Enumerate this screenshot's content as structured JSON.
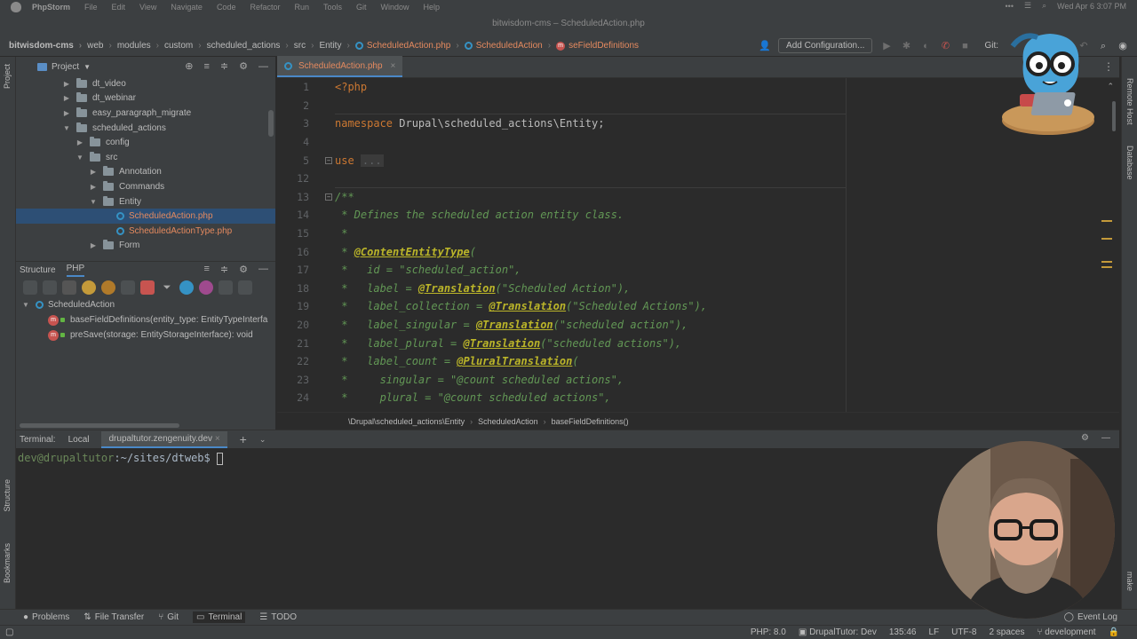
{
  "menubar": {
    "app": "PhpStorm",
    "items": [
      "File",
      "Edit",
      "View",
      "Navigate",
      "Code",
      "Refactor",
      "Run",
      "Tools",
      "Git",
      "Window",
      "Help"
    ],
    "window_title": "bitwisdom-cms – ScheduledAction.php",
    "datetime": "Wed Apr 6  3:07 PM"
  },
  "navbar": {
    "crumbs": [
      "bitwisdom-cms",
      "web",
      "modules",
      "custom",
      "scheduled_actions",
      "src",
      "Entity",
      "ScheduledAction.php",
      "ScheduledAction",
      "seFieldDefinitions"
    ],
    "add_configuration": "Add Configuration...",
    "git_label": "Git:"
  },
  "left_strip": {
    "project": "Project",
    "structure": "Structure",
    "bookmarks": "Bookmarks"
  },
  "right_strip": {
    "remote_host": "Remote Host",
    "database": "Database",
    "make": "make"
  },
  "project_pane": {
    "title": "Project",
    "tree": [
      {
        "label": "dt_video",
        "type": "folder",
        "indent": 1,
        "arrow": "▶"
      },
      {
        "label": "dt_webinar",
        "type": "folder",
        "indent": 1,
        "arrow": "▶"
      },
      {
        "label": "easy_paragraph_migrate",
        "type": "folder",
        "indent": 1,
        "arrow": "▶"
      },
      {
        "label": "scheduled_actions",
        "type": "folder",
        "indent": 1,
        "arrow": "▼"
      },
      {
        "label": "config",
        "type": "folder",
        "indent": 2,
        "arrow": "▶"
      },
      {
        "label": "src",
        "type": "folder",
        "indent": 2,
        "arrow": "▼"
      },
      {
        "label": "Annotation",
        "type": "folder",
        "indent": 3,
        "arrow": "▶"
      },
      {
        "label": "Commands",
        "type": "folder",
        "indent": 3,
        "arrow": "▶"
      },
      {
        "label": "Entity",
        "type": "folder",
        "indent": 3,
        "arrow": "▼"
      },
      {
        "label": "ScheduledAction.php",
        "type": "php",
        "indent": 4,
        "arrow": "",
        "selected": true
      },
      {
        "label": "ScheduledActionType.php",
        "type": "php",
        "indent": 4,
        "arrow": ""
      },
      {
        "label": "Form",
        "type": "folder",
        "indent": 3,
        "arrow": "▶"
      }
    ]
  },
  "structure_pane": {
    "tab_structure": "Structure",
    "tab_php": "PHP",
    "class_name": "ScheduledAction",
    "members": [
      "baseFieldDefinitions(entity_type: EntityTypeInterfa",
      "preSave(storage: EntityStorageInterface): void"
    ]
  },
  "editor": {
    "tab_label": "ScheduledAction.php",
    "lines": [
      {
        "n": "1",
        "html": "<span class='kw'>&lt;?php</span>"
      },
      {
        "n": "2",
        "html": ""
      },
      {
        "n": "3",
        "html": "<span class='kw'>namespace</span> Drupal\\scheduled_actions\\Entity;"
      },
      {
        "n": "4",
        "html": ""
      },
      {
        "n": "5",
        "html": "<span class='kw'>use</span> <span class='fold'>...</span>"
      },
      {
        "n": "12",
        "html": ""
      },
      {
        "n": "13",
        "html": "<span class='cm'>/**</span>"
      },
      {
        "n": "14",
        "html": "<span class='cm'> * Defines the scheduled action entity class.</span>"
      },
      {
        "n": "15",
        "html": "<span class='cm'> *</span>"
      },
      {
        "n": "16",
        "html": "<span class='cm'> * </span><span class='an'>@ContentEntityType</span><span class='cm'>(</span>"
      },
      {
        "n": "17",
        "html": "<span class='cm'> *   id = \"scheduled_action\",</span>"
      },
      {
        "n": "18",
        "html": "<span class='cm'> *   label = </span><span class='an'>@Translation</span><span class='cm'>(\"Scheduled Action\"),</span>"
      },
      {
        "n": "19",
        "html": "<span class='cm'> *   label_collection = </span><span class='an'>@Translation</span><span class='cm'>(\"Scheduled Actions\"),</span>"
      },
      {
        "n": "20",
        "html": "<span class='cm'> *   label_singular = </span><span class='an'>@Translation</span><span class='cm'>(\"scheduled action\"),</span>"
      },
      {
        "n": "21",
        "html": "<span class='cm'> *   label_plural = </span><span class='an'>@Translation</span><span class='cm'>(\"scheduled actions\"),</span>"
      },
      {
        "n": "22",
        "html": "<span class='cm'> *   label_count = </span><span class='an'>@PluralTranslation</span><span class='cm'>(</span>"
      },
      {
        "n": "23",
        "html": "<span class='cm'> *     singular = \"@count scheduled actions\",</span>"
      },
      {
        "n": "24",
        "html": "<span class='cm'> *     plural = \"@count scheduled actions\",</span>"
      }
    ],
    "breadcrumb": [
      "\\Drupal\\scheduled_actions\\Entity",
      "ScheduledAction",
      "baseFieldDefinitions()"
    ]
  },
  "terminal": {
    "label": "Terminal:",
    "tabs": [
      "Local",
      "drupaltutor.zengenuity.dev"
    ],
    "prompt_user": "dev@drupaltutor",
    "prompt_path": ":~/sites/dtweb$ "
  },
  "bottom_toolbar": {
    "items": [
      "Problems",
      "File Transfer",
      "Git",
      "Terminal",
      "TODO"
    ],
    "event_log": "Event Log"
  },
  "status_bar": {
    "php": "PHP: 8.0",
    "server": "DrupalTutor: Dev",
    "position": "135:46",
    "line_sep": "LF",
    "encoding": "UTF-8",
    "indent": "2 spaces",
    "branch": "development"
  },
  "colors": {
    "accent": "#4a88c7",
    "php_file": "#e58a5f",
    "keyword": "#cc7832",
    "comment": "#629755",
    "annotation": "#bbb529"
  }
}
